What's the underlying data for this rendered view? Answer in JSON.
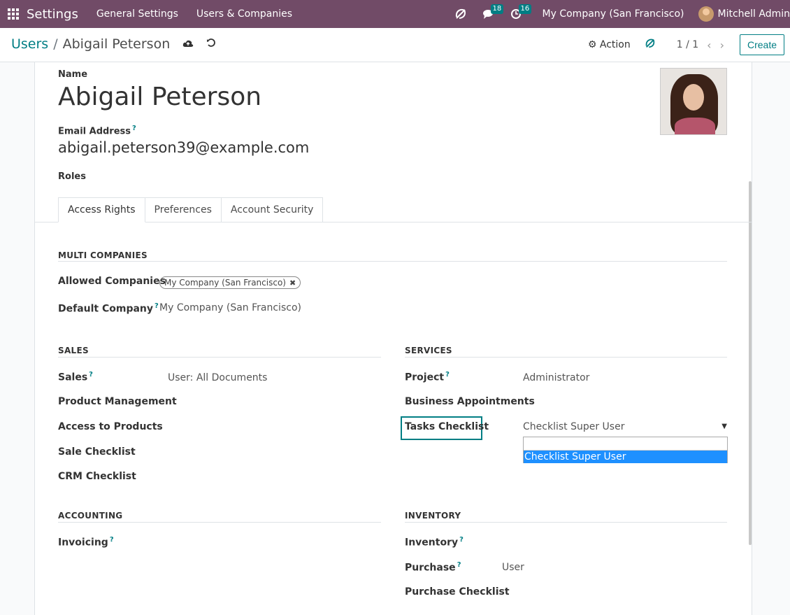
{
  "navbar": {
    "app_name": "Settings",
    "menus": [
      "General Settings",
      "Users & Companies"
    ],
    "messages_count": "18",
    "activities_count": "16",
    "company": "My Company (San Francisco)",
    "user": "Mitchell Admin"
  },
  "control": {
    "breadcrumb_parent": "Users",
    "breadcrumb_sep": "/",
    "breadcrumb_current": "Abigail Peterson",
    "action_label": "Action",
    "pager": "1 / 1",
    "create_label": "Create"
  },
  "form": {
    "name_label": "Name",
    "name_value": "Abigail Peterson",
    "email_label": "Email Address",
    "email_value": "abigail.peterson39@example.com",
    "roles_label": "Roles",
    "help_mark": "?"
  },
  "tabs": [
    "Access Rights",
    "Preferences",
    "Account Security"
  ],
  "multi_companies": {
    "title": "MULTI COMPANIES",
    "allowed_label": "Allowed Companies",
    "allowed_tag": "My Company (San Francisco)",
    "default_label": "Default Company",
    "default_value": "My Company (San Francisco)"
  },
  "sales": {
    "title": "SALES",
    "sales_label": "Sales",
    "sales_value": "User: All Documents",
    "product_management": "Product Management",
    "access_products": "Access to Products",
    "sale_checklist": "Sale Checklist",
    "crm_checklist": "CRM Checklist"
  },
  "services": {
    "title": "SERVICES",
    "project_label": "Project",
    "project_value": "Administrator",
    "business_appointments": "Business Appointments",
    "tasks_checklist_label": "Tasks Checklist",
    "tasks_checklist_value": "Checklist Super User",
    "dropdown_option": "Checklist Super User"
  },
  "accounting": {
    "title": "ACCOUNTING",
    "invoicing_label": "Invoicing"
  },
  "inventory": {
    "title": "INVENTORY",
    "inventory_label": "Inventory",
    "purchase_label": "Purchase",
    "purchase_value": "User",
    "purchase_checklist": "Purchase Checklist"
  }
}
